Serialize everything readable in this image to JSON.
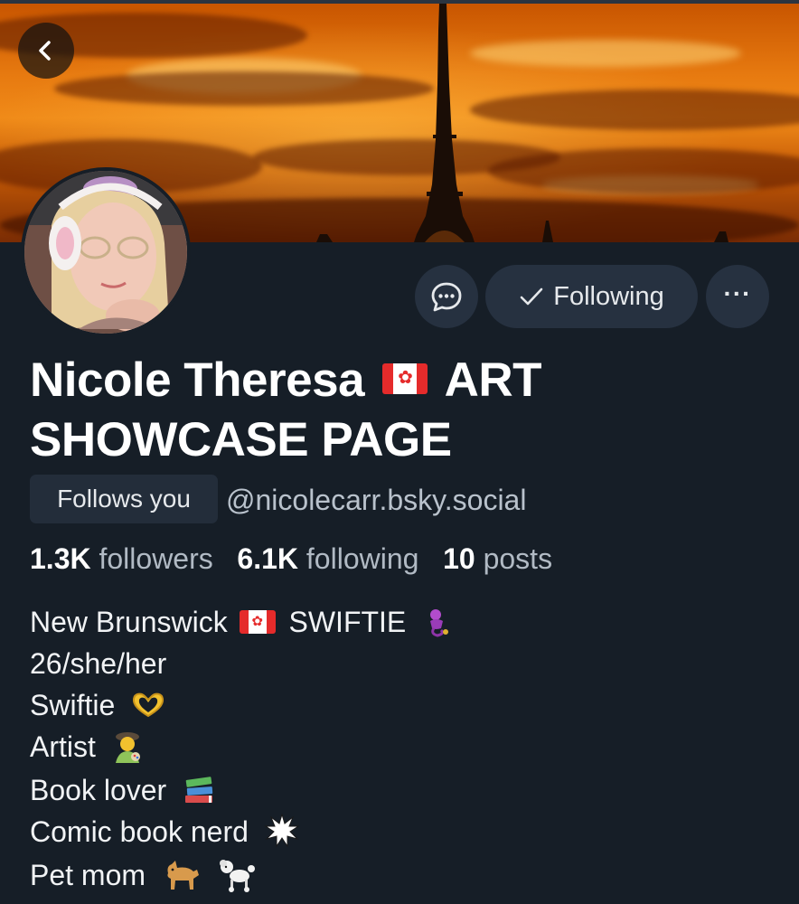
{
  "profile": {
    "name_line1": "Nicole Theresa",
    "name_after_flag": "ART",
    "name_line2": "SHOWCASE PAGE",
    "follows_badge": "Follows you",
    "handle": "@nicolecarr.bsky.social"
  },
  "actions": {
    "following_label": "Following",
    "more_label": "···"
  },
  "stats": {
    "followers_count": "1.3K",
    "followers_label": "followers",
    "following_count": "6.1K",
    "following_label": "following",
    "posts_count": "10",
    "posts_label": "posts"
  },
  "bio": {
    "line1": "New Brunswick",
    "line1b": "SWIFTIE",
    "line2": "26/she/her",
    "line3": "Swiftie",
    "line4": "Artist",
    "line5": "Book lover",
    "line6": "Comic book nerd",
    "line7": "Pet mom"
  },
  "icons": {
    "back": "chevron-left-icon",
    "message": "chat-bubble-icon",
    "check": "checkmark-icon",
    "flag": "canada-flag-icon",
    "genie": "genie-emoji",
    "heart_hands": "heart-hands-emoji",
    "artist": "artist-emoji",
    "books": "books-emoji",
    "explosion": "explosion-emoji",
    "dog": "dog-emoji",
    "poodle": "poodle-emoji"
  },
  "colors": {
    "background": "#161e27",
    "button_bg": "#263140",
    "badge_bg": "#232d3a",
    "text_primary": "#ffffff",
    "text_muted": "#b1bac4",
    "flag_red": "#e52b2b"
  }
}
